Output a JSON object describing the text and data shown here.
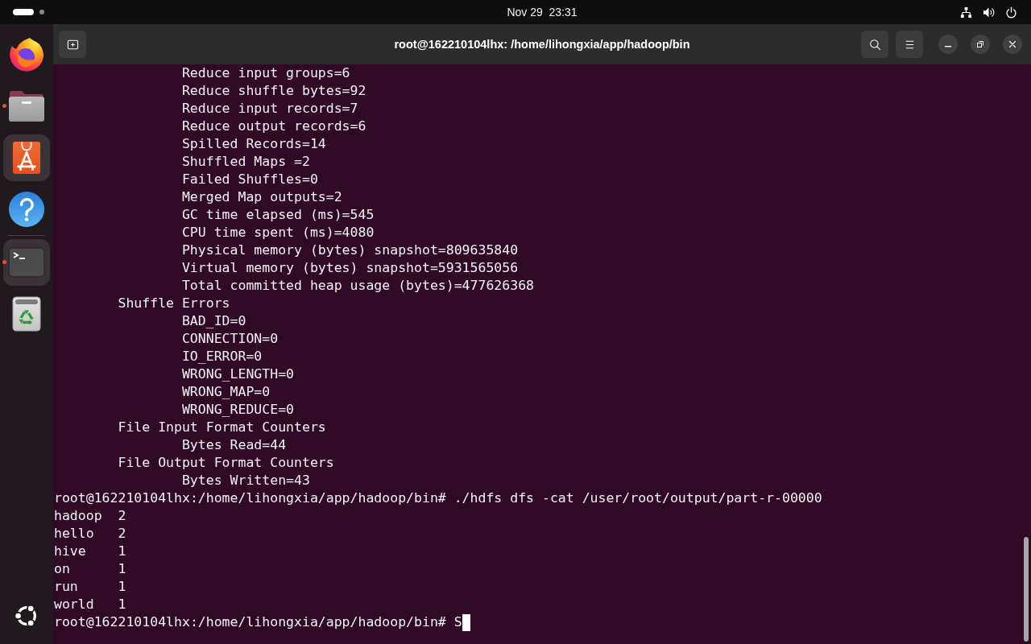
{
  "top_bar": {
    "workspaces": [
      {
        "selected": true
      },
      {
        "selected": false
      }
    ],
    "clock": "Nov 29  23:31"
  },
  "dock": {
    "items": [
      {
        "kind": "browser",
        "running": false,
        "highlighted": false
      },
      {
        "kind": "files",
        "running": true,
        "highlighted": false
      },
      {
        "kind": "app_store",
        "running": false,
        "highlighted": true
      },
      {
        "kind": "help",
        "running": false,
        "highlighted": false
      },
      {
        "kind": "separator"
      },
      {
        "kind": "terminal",
        "running": true,
        "highlighted": true
      },
      {
        "kind": "trash",
        "running": false,
        "highlighted": false
      }
    ]
  },
  "window": {
    "title": "root@162210104lhx: /home/lihongxia/app/hadoop/bin"
  },
  "terminal": {
    "counter_groups": [
      {
        "children": [
          "Reduce input groups=6",
          "Reduce shuffle bytes=92",
          "Reduce input records=7",
          "Reduce output records=6",
          "Spilled Records=14",
          "Shuffled Maps =2",
          "Failed Shuffles=0",
          "Merged Map outputs=2",
          "GC time elapsed (ms)=545",
          "CPU time spent (ms)=4080",
          "Physical memory (bytes) snapshot=809635840",
          "Virtual memory (bytes) snapshot=5931565056",
          "Total committed heap usage (bytes)=477626368"
        ]
      },
      {
        "title": "Shuffle Errors",
        "children": [
          "BAD_ID=0",
          "CONNECTION=0",
          "IO_ERROR=0",
          "WRONG_LENGTH=0",
          "WRONG_MAP=0",
          "WRONG_REDUCE=0"
        ]
      },
      {
        "title": "File Input Format Counters",
        "children": [
          "Bytes Read=44"
        ]
      },
      {
        "title": "File Output Format Counters",
        "children": [
          "Bytes Written=43"
        ]
      }
    ],
    "command_line": {
      "prompt": "root@162210104lhx:/home/lihongxia/app/hadoop/bin#",
      "input": "./hdfs dfs -cat /user/root/output/part-r-00000"
    },
    "output_rows": [
      {
        "word": "hadoop",
        "count": "2"
      },
      {
        "word": "hello",
        "count": "2"
      },
      {
        "word": "hive",
        "count": "1"
      },
      {
        "word": "on",
        "count": "1"
      },
      {
        "word": "run",
        "count": "1"
      },
      {
        "word": "world",
        "count": "1"
      }
    ],
    "input_line": {
      "prompt": "root@162210104lhx:/home/lihongxia/app/hadoop/bin#",
      "input": "S"
    }
  }
}
